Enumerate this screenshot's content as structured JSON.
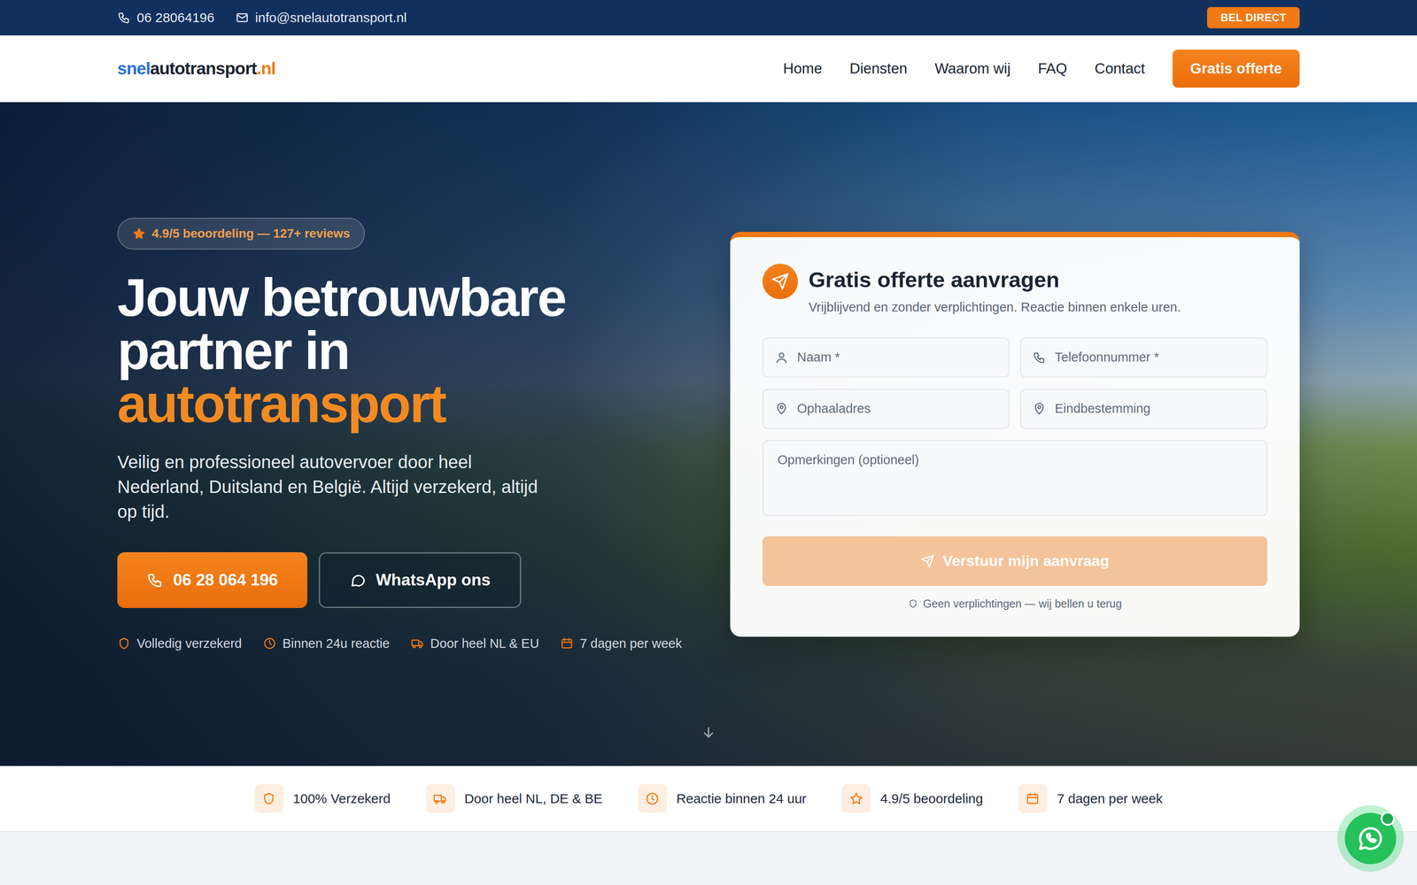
{
  "topbar": {
    "phone": "06 28064196",
    "email": "info@snelautotransport.nl",
    "cta": "BEL DIRECT"
  },
  "logo": {
    "part1": "snel",
    "part2": "autotransport",
    "part3": ".nl"
  },
  "nav": {
    "links": [
      {
        "label": "Home"
      },
      {
        "label": "Diensten"
      },
      {
        "label": "Waarom wij"
      },
      {
        "label": "FAQ"
      },
      {
        "label": "Contact"
      }
    ],
    "cta": "Gratis offerte"
  },
  "hero": {
    "rating_badge": "4.9/5 beoordeling — 127+ reviews",
    "title": "Jouw betrouwbare partner in",
    "title_highlight": "autotransport",
    "subtitle": "Veilig en professioneel autovervoer door heel Nederland, Duitsland en België. Altijd verzekerd, altijd op tijd.",
    "buttons": [
      {
        "label": "06 28 064 196",
        "kind": "primary"
      },
      {
        "label": "WhatsApp ons",
        "kind": "outline"
      }
    ],
    "features": [
      "Volledig verzekerd",
      "Binnen 24u reactie",
      "Door heel NL & EU",
      "7 dagen per week"
    ]
  },
  "form": {
    "title": "Gratis offerte aanvragen",
    "subtitle": "Vrijblijvend en zonder verplichtingen. Reactie binnen enkele uren.",
    "fields": [
      {
        "placeholder": "Naam *"
      },
      {
        "placeholder": "Telefoonnummer *"
      },
      {
        "placeholder": "Ophaaladres"
      },
      {
        "placeholder": "Eindbestemming"
      }
    ],
    "textarea": {
      "placeholder": "Opmerkingen (optioneel)"
    },
    "submit": {
      "label": "Verstuur mijn aanvraag",
      "disabled": true
    },
    "note": "Geen verplichtingen — wij bellen u terug"
  },
  "trust": [
    "100% Verzekerd",
    "Door heel NL, DE & BE",
    "Reactie binnen 24 uur",
    "4.9/5 beoordeling",
    "7 dagen per week"
  ],
  "whatsapp_float": {
    "online": true
  }
}
